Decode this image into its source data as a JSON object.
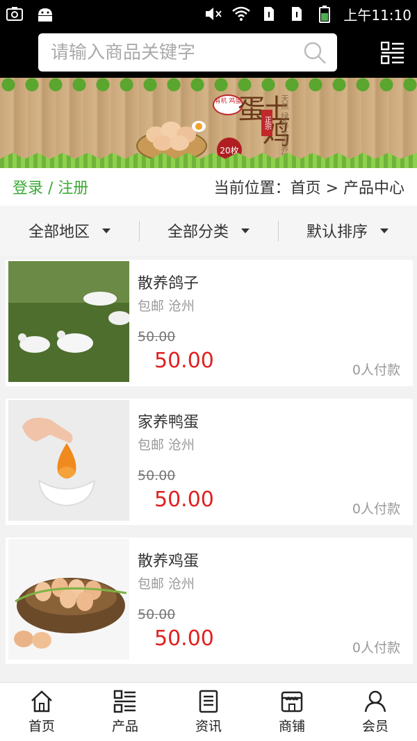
{
  "status_bar": {
    "time": "上午11:10",
    "icons": [
      "screenshot-icon",
      "android-icon",
      "mute-icon",
      "wifi-icon",
      "sim1-icon",
      "sim2-icon",
      "battery-icon"
    ]
  },
  "search": {
    "placeholder": "请输入商品关键字",
    "search_icon": "search-icon",
    "menu_icon": "grid-list-icon"
  },
  "banner": {
    "organic_label": "有机\n鸡蛋",
    "title": "土鸡蛋",
    "tag": "正宗",
    "count_badge": "20枚",
    "side_text": "天然 绿色 生态养殖"
  },
  "location_bar": {
    "login_label": "登录 / 注册",
    "breadcrumb": "当前位置：首页 > 产品中心"
  },
  "filters": [
    {
      "label": "全部地区"
    },
    {
      "label": "全部分类"
    },
    {
      "label": "默认排序"
    }
  ],
  "products": [
    {
      "name": "散养鸽子",
      "meta": "包邮 沧州",
      "old_price": "50.00",
      "price": "50.00",
      "paid": "0人付款"
    },
    {
      "name": "家养鸭蛋",
      "meta": "包邮 沧州",
      "old_price": "50.00",
      "price": "50.00",
      "paid": "0人付款"
    },
    {
      "name": "散养鸡蛋",
      "meta": "包邮 沧州",
      "old_price": "50.00",
      "price": "50.00",
      "paid": "0人付款"
    }
  ],
  "bottom_nav": [
    {
      "label": "首页",
      "icon": "home-icon"
    },
    {
      "label": "产品",
      "icon": "grid-list-icon"
    },
    {
      "label": "资讯",
      "icon": "news-icon"
    },
    {
      "label": "商铺",
      "icon": "store-icon"
    },
    {
      "label": "会员",
      "icon": "user-icon"
    }
  ],
  "colors": {
    "accent_green": "#3aaa35",
    "price_red": "#e02020",
    "header_bg": "#000000"
  }
}
